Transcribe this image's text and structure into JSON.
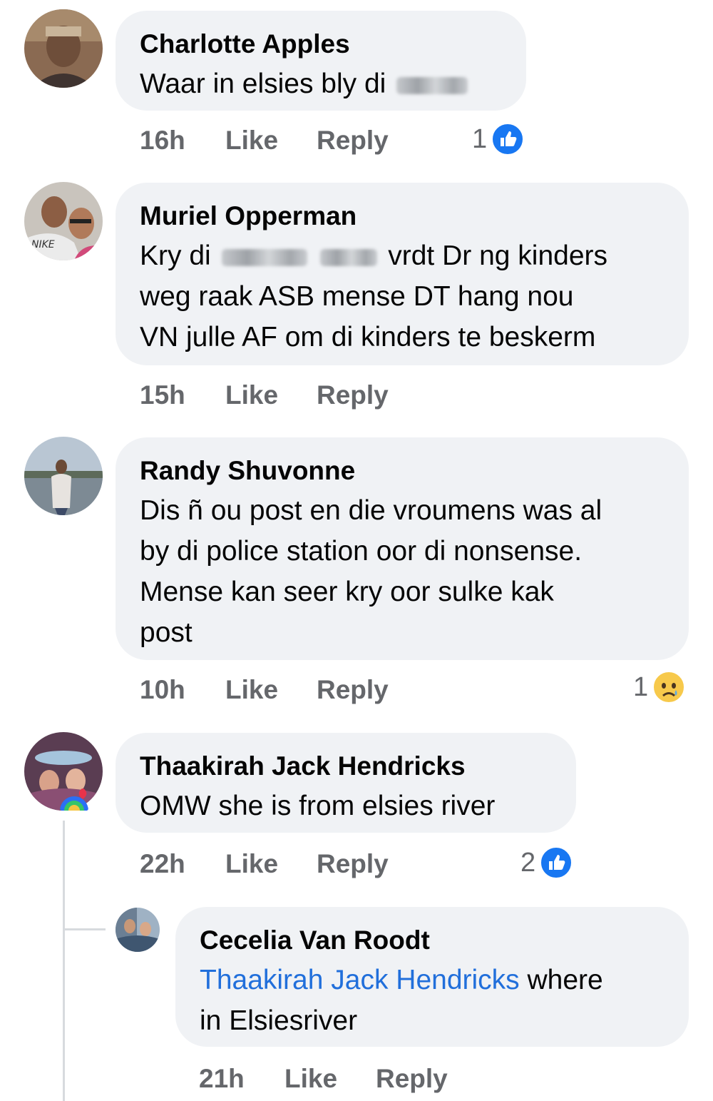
{
  "comments": [
    {
      "author": "Charlotte Apples",
      "text_before_redaction": "Waar in elsies bly di",
      "time": "16h",
      "like_label": "Like",
      "reply_label": "Reply",
      "reaction_count": "1",
      "reaction_icon": "like-icon"
    },
    {
      "author": "Muriel Opperman",
      "lines": [
        "Kry di",
        "vrdt Dr ng kinders",
        "weg raak ASB mense DT hang nou",
        "VN julle AF om di kinders te beskerm"
      ],
      "time": "15h",
      "like_label": "Like",
      "reply_label": "Reply"
    },
    {
      "author": "Randy Shuvonne",
      "lines": [
        "Dis ñ ou post en die vroumens was al",
        "by di police station oor di nonsense.",
        "Mense kan seer kry oor sulke kak",
        "post"
      ],
      "time": "10h",
      "like_label": "Like",
      "reply_label": "Reply",
      "reaction_count": "1",
      "reaction_icon": "sad-face-icon"
    },
    {
      "author": "Thaakirah Jack Hendricks",
      "text": "OMW she is from elsies river",
      "time": "22h",
      "like_label": "Like",
      "reply_label": "Reply",
      "reaction_count": "2",
      "reaction_icon": "like-icon"
    }
  ],
  "reply": {
    "author": "Cecelia Van Roodt",
    "mention": "Thaakirah Jack Hendricks",
    "line1_rest": " where",
    "line2": "in Elsiesriver",
    "time": "21h",
    "like_label": "Like",
    "reply_label": "Reply"
  },
  "colors": {
    "bubble": "#f0f2f5",
    "action_text": "#65676b",
    "mention": "#216fdb",
    "like_blue": "#1877f2"
  }
}
